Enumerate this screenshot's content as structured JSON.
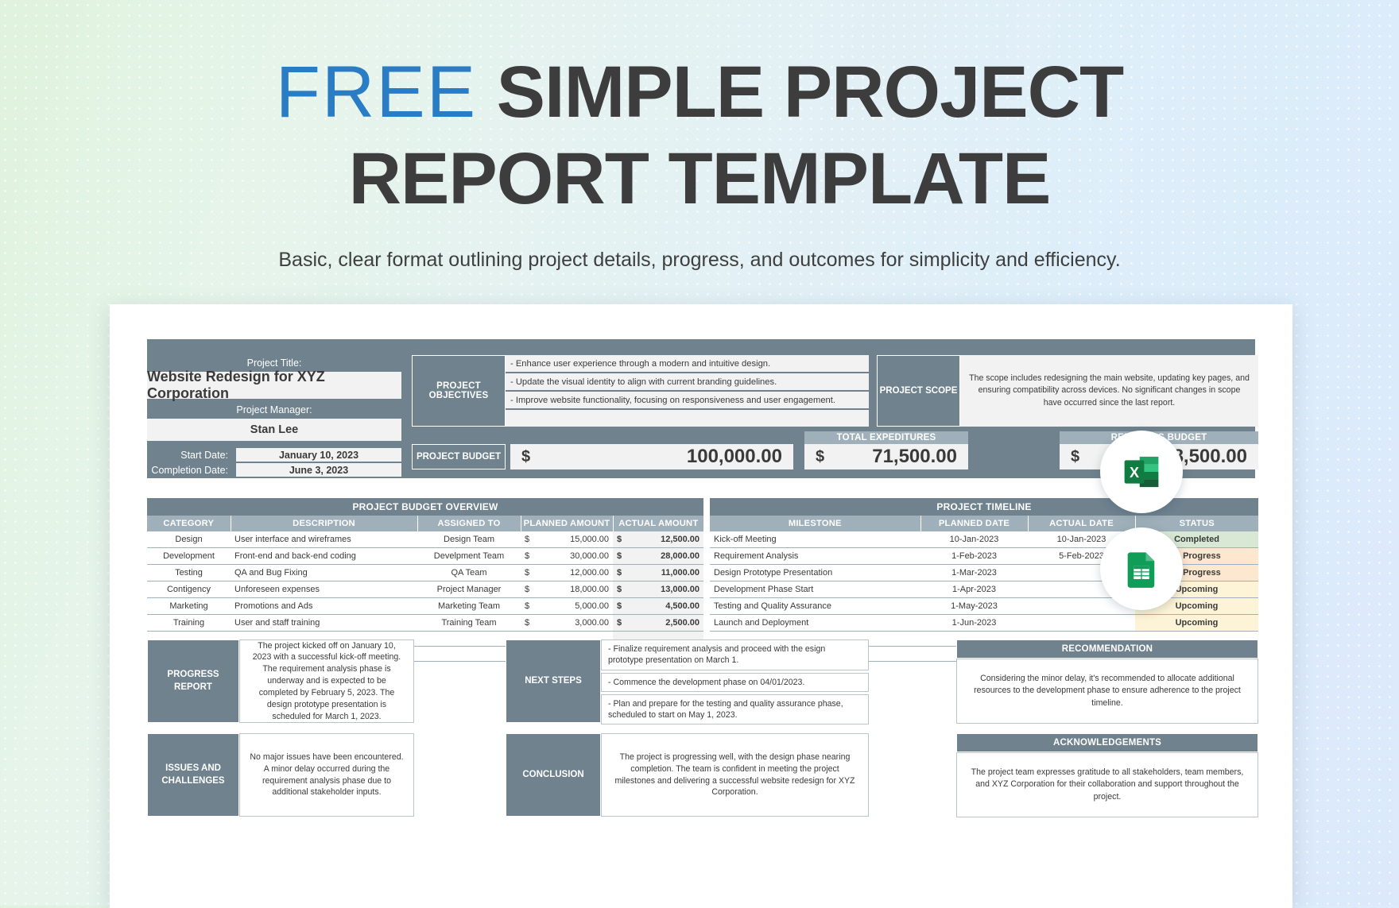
{
  "hero": {
    "title_free": "FREE",
    "title_rest": "SIMPLE PROJECT",
    "title_line2": "REPORT TEMPLATE",
    "subtitle": "Basic, clear format outlining project details, progress, and outcomes for simplicity and efficiency."
  },
  "colors": {
    "accent_blue": "#2a7dc4",
    "header_slate": "#6f828e",
    "subheader_slate": "#9fb0ba",
    "cell_grey": "#f2f2f2",
    "status_completed": "#d9e8d4",
    "status_in_progress": "#fde8cf",
    "status_upcoming": "#fdf3d6"
  },
  "header": {
    "project_title_label": "Project Title:",
    "project_title_value": "Website Redesign for XYZ Corporation",
    "project_manager_label": "Project Manager:",
    "project_manager_value": "Stan Lee",
    "start_date_label": "Start Date:",
    "start_date_value": "January 10, 2023",
    "completion_date_label": "Completion Date:",
    "completion_date_value": "June 3, 2023",
    "objectives_label": "PROJECT OBJECTIVES",
    "objectives": [
      "- Enhance user experience through a modern and intuitive design.",
      "- Update the visual identity to align with current branding guidelines.",
      "- Improve website functionality, focusing on responsiveness and user engagement.",
      ""
    ],
    "scope_label": "PROJECT SCOPE",
    "scope_value": "The scope includes redesigning the main website, updating key pages, and ensuring compatibility across devices. No significant changes in scope have occurred since the last report."
  },
  "budget": {
    "project_budget_label": "PROJECT BUDGET",
    "project_budget_currency": "$",
    "project_budget_value": "100,000.00",
    "total_expenditures_label": "TOTAL EXPEDITURES",
    "total_expenditures_currency": "$",
    "total_expenditures_value": "71,500.00",
    "remaining_budget_label": "REMAINING BUDGET",
    "remaining_budget_currency": "$",
    "remaining_budget_value": "28,500.00"
  },
  "budget_table": {
    "band": "PROJECT BUDGET OVERVIEW",
    "columns": [
      "CATEGORY",
      "DESCRIPTION",
      "ASSIGNED TO",
      "PLANNED AMOUNT",
      "ACTUAL AMOUNT"
    ],
    "rows": [
      {
        "category": "Design",
        "description": "User interface and wireframes",
        "assigned": "Design Team",
        "planned_cur": "$",
        "planned": "15,000.00",
        "actual_cur": "$",
        "actual": "12,500.00"
      },
      {
        "category": "Development",
        "description": "Front-end and back-end coding",
        "assigned": "Develpment Team",
        "planned_cur": "$",
        "planned": "30,000.00",
        "actual_cur": "$",
        "actual": "28,000.00"
      },
      {
        "category": "Testing",
        "description": "QA and Bug Fixing",
        "assigned": "QA Team",
        "planned_cur": "$",
        "planned": "12,000.00",
        "actual_cur": "$",
        "actual": "11,000.00"
      },
      {
        "category": "Contigency",
        "description": "Unforeseen expenses",
        "assigned": "Project Manager",
        "planned_cur": "$",
        "planned": "18,000.00",
        "actual_cur": "$",
        "actual": "13,000.00"
      },
      {
        "category": "Marketing",
        "description": "Promotions and Ads",
        "assigned": "Marketing Team",
        "planned_cur": "$",
        "planned": "5,000.00",
        "actual_cur": "$",
        "actual": "4,500.00"
      },
      {
        "category": "Training",
        "description": "User and staff training",
        "assigned": "Training Team",
        "planned_cur": "$",
        "planned": "3,000.00",
        "actual_cur": "$",
        "actual": "2,500.00"
      }
    ]
  },
  "timeline_table": {
    "band": "PROJECT TIMELINE",
    "columns": [
      "MILESTONE",
      "PLANNED DATE",
      "ACTUAL DATE",
      "STATUS"
    ],
    "rows": [
      {
        "milestone": "Kick-off Meeting",
        "planned": "10-Jan-2023",
        "actual": "10-Jan-2023",
        "status": "Completed",
        "status_kind": "completed"
      },
      {
        "milestone": "Requirement Analysis",
        "planned": "1-Feb-2023",
        "actual": "5-Feb-2023",
        "status": "In Progress",
        "status_kind": "progress"
      },
      {
        "milestone": "Design Prototype Presentation",
        "planned": "1-Mar-2023",
        "actual": "",
        "status": "In Progress",
        "status_kind": "progress"
      },
      {
        "milestone": "Development Phase Start",
        "planned": "1-Apr-2023",
        "actual": "",
        "status": "Upcoming",
        "status_kind": "upcoming"
      },
      {
        "milestone": "Testing and Quality Assurance",
        "planned": "1-May-2023",
        "actual": "",
        "status": "Upcoming",
        "status_kind": "upcoming"
      },
      {
        "milestone": "Launch and Deployment",
        "planned": "1-Jun-2023",
        "actual": "",
        "status": "Upcoming",
        "status_kind": "upcoming"
      }
    ]
  },
  "panels": {
    "progress_report_label": "PROGRESS REPORT",
    "progress_report_text": "The project kicked off on January 10, 2023 with a successful  kick-off meeting. The requirement analysis phase is underway and is expected to be completed by February 5, 2023. The design prototype presentation is scheduled for March 1, 2023.",
    "issues_label": "ISSUES AND CHALLENGES",
    "issues_text": "No major issues have been encountered. A minor delay occurred during the requirement analysis phase due to additional stakeholder inputs.",
    "next_steps_label": "NEXT STEPS",
    "next_steps": [
      "- Finalize requirement analysis and proceed with the esign prototype presentation on March 1.",
      "- Commence the development phase on 04/01/2023.",
      "- Plan and prepare for the testing and quality assurance phase, scheduled to start on May 1, 2023."
    ],
    "conclusion_label": "CONCLUSION",
    "conclusion_text": "The project is progressing well, with the design phase nearing completion. The team is confident in meeting the project milestones and delivering a successful website  redesign for XYZ Corporation.",
    "recommendation_label": "RECOMMENDATION",
    "recommendation_text": "Considering the minor delay, it's recommended to allocate additional resources to the development phase to ensure adherence to the project timeline.",
    "acknowledgements_label": "ACKNOWLEDGEMENTS",
    "acknowledgements_text": "The project team expresses gratitude to all stakeholders, team members, and XYZ Corporation for their collaboration and support throughout the project."
  },
  "badges": {
    "excel": "excel-icon",
    "sheets": "google-sheets-icon"
  }
}
